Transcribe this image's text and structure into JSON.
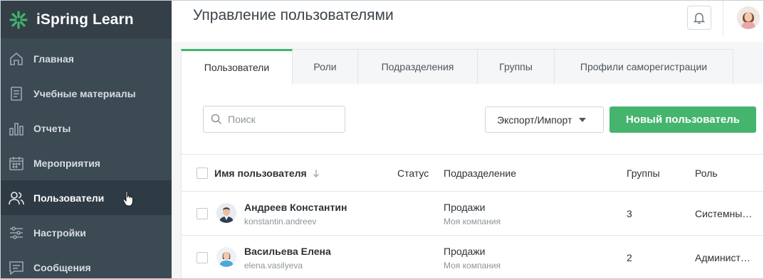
{
  "app": {
    "brand": "iSpring Learn",
    "accent": "#45b56e",
    "sidebar_bg": "#3c4a54"
  },
  "sidebar": {
    "items": [
      {
        "label": "Главная",
        "icon": "home-icon"
      },
      {
        "label": "Учебные материалы",
        "icon": "book-icon"
      },
      {
        "label": "Отчеты",
        "icon": "bar-chart-icon"
      },
      {
        "label": "Мероприятия",
        "icon": "calendar-icon"
      },
      {
        "label": "Пользователи",
        "icon": "users-icon",
        "active": true
      },
      {
        "label": "Настройки",
        "icon": "sliders-icon"
      },
      {
        "label": "Сообщения",
        "icon": "message-icon"
      }
    ]
  },
  "header": {
    "title": "Управление пользователями",
    "notifications_icon": "bell-icon"
  },
  "tabs": [
    {
      "label": "Пользователи",
      "active": true
    },
    {
      "label": "Роли"
    },
    {
      "label": "Подразделения"
    },
    {
      "label": "Группы"
    },
    {
      "label": "Профили саморегистрации"
    }
  ],
  "toolbar": {
    "search_placeholder": "Поиск",
    "export_label": "Экспорт/Импорт",
    "new_user_label": "Новый пользователь"
  },
  "table": {
    "columns": {
      "name": "Имя пользователя",
      "status": "Статус",
      "department": "Подразделение",
      "groups": "Группы",
      "role": "Роль"
    },
    "rows": [
      {
        "name": "Андреев Константин",
        "login": "konstantin.andreev",
        "department": "Продажи",
        "organization": "Моя компания",
        "groups": "3",
        "role": "Системный администратор"
      },
      {
        "name": "Васильева Елена",
        "login": "elena.vasilyeva",
        "department": "Продажи",
        "organization": "Моя компания",
        "groups": "2",
        "role": "Администратор"
      }
    ]
  }
}
